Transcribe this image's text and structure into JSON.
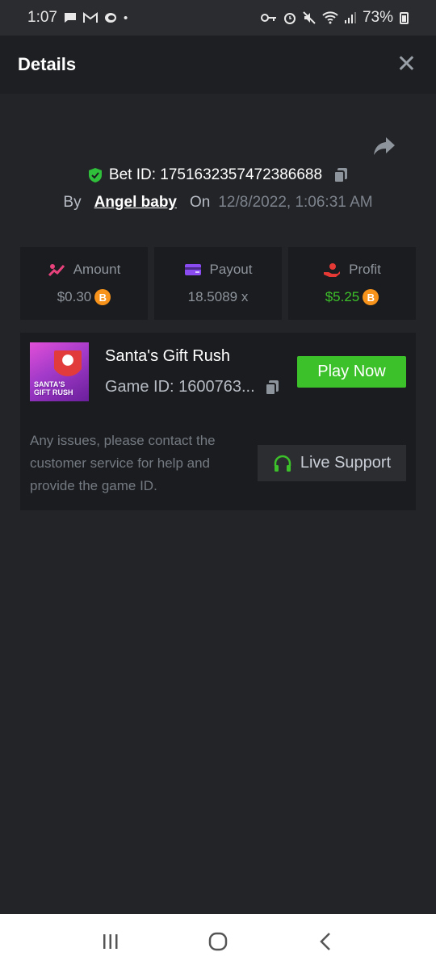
{
  "status_bar": {
    "time": "1:07",
    "battery": "73%",
    "left_icons": [
      "message-icon",
      "gmail-icon",
      "chat-icon",
      "dot-icon"
    ],
    "right_icons": [
      "key-icon",
      "alarm-icon",
      "mute-icon",
      "wifi-icon",
      "signal-icon",
      "battery-icon"
    ]
  },
  "header": {
    "title": "Details",
    "close_symbol": "✕"
  },
  "bet": {
    "id_label": "Bet ID: 1751632357472386688",
    "by_label": "By",
    "user": "Angel baby",
    "on_label": "On",
    "date": "12/8/2022, 1:06:31 AM"
  },
  "stats": {
    "amount_label": "Amount",
    "amount_value": "$0.30",
    "payout_label": "Payout",
    "payout_value": "18.5089 x",
    "profit_label": "Profit",
    "profit_value": "$5.25",
    "currency_symbol": "B"
  },
  "game": {
    "title": "Santa's Gift Rush",
    "id_label": "Game ID: 1600763...",
    "thumb_text": "SANTA'S GIFT RUSH",
    "play_label": "Play Now"
  },
  "support": {
    "issues_text": "Any issues, please contact the customer service for help and provide the game ID.",
    "button_label": "Live Support"
  },
  "colors": {
    "background": "#232428",
    "header": "#1e1f22",
    "accent_green": "#3dc12a",
    "bitcoin": "#f7931a",
    "amount_icon": "#e8427c",
    "payout_icon": "#8a4cf0",
    "profit_icon": "#e53935"
  }
}
